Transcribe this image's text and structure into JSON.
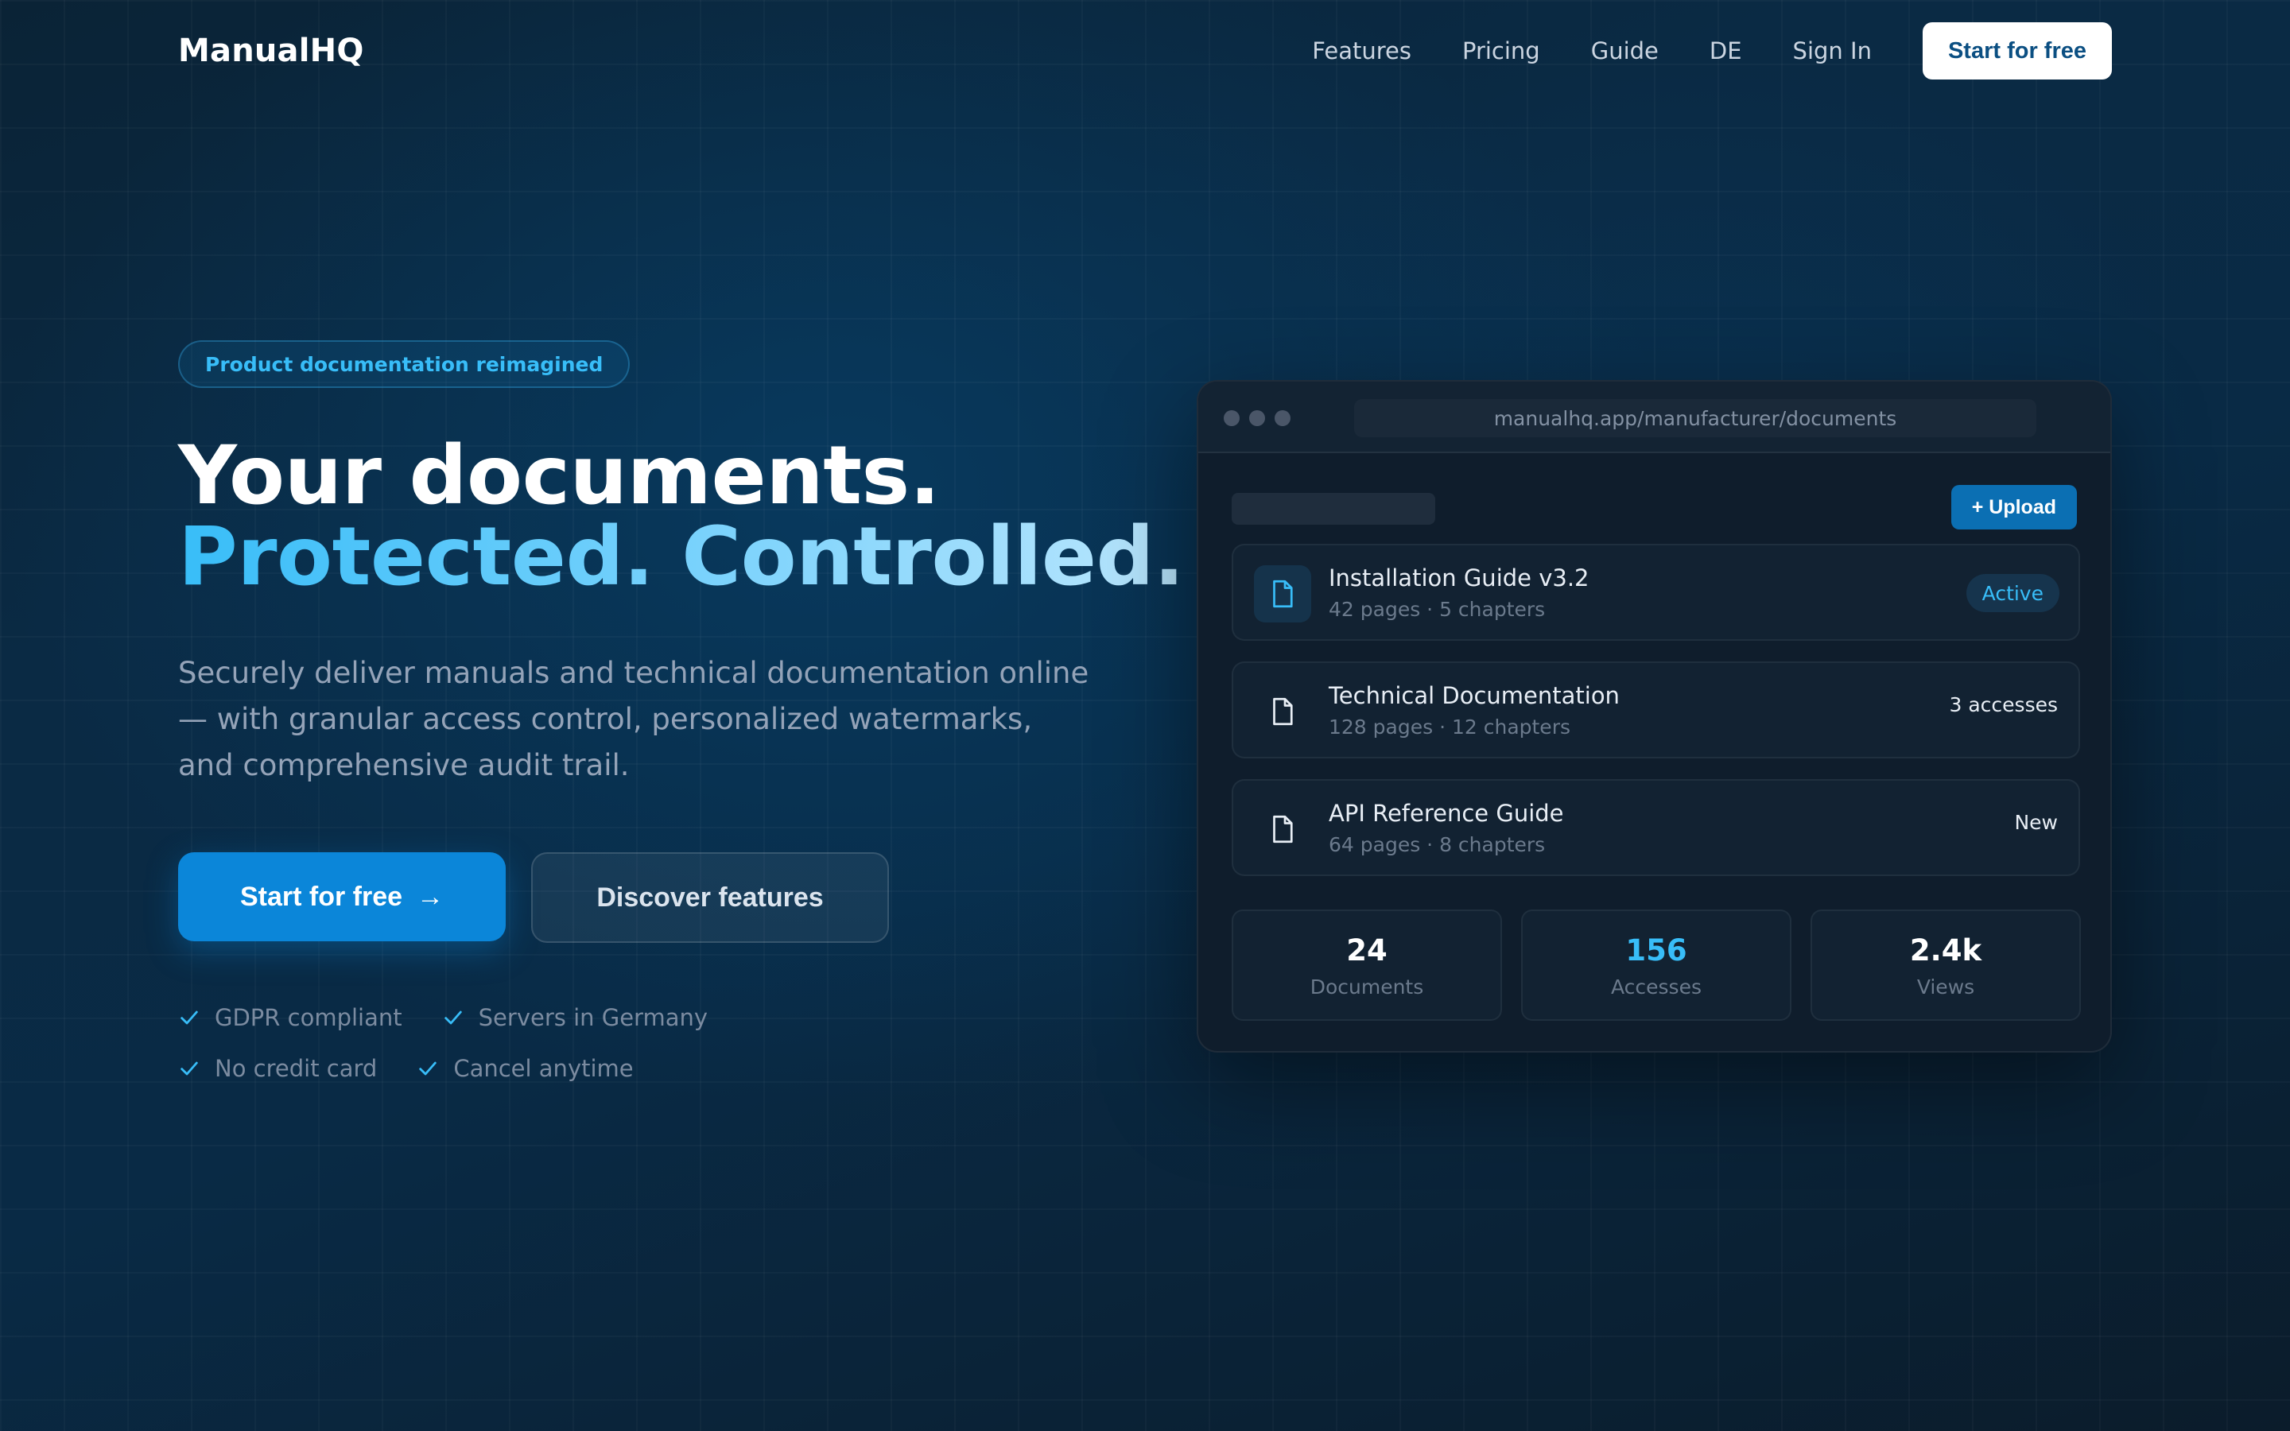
{
  "brand": {
    "name": "ManualHQ"
  },
  "nav": {
    "items": [
      "Features",
      "Pricing",
      "Guide",
      "DE",
      "Sign In"
    ],
    "cta": "Start for free"
  },
  "hero": {
    "badge": "Product documentation reimagined",
    "headline_line1": "Your documents.",
    "headline_line2": "Protected. Controlled.",
    "subtitle": "Securely deliver manuals and technical documentation online — with granular access control, personalized watermarks, and comprehensive audit trail.",
    "primary_button": "Start for free",
    "primary_button_arrow": "→",
    "secondary_button": "Discover features",
    "checks": [
      "GDPR compliant",
      "Servers in Germany",
      "No credit card",
      "Cancel anytime"
    ]
  },
  "mockup": {
    "url": "manualhq.app/manufacturer/documents",
    "upload_button": "+ Upload",
    "documents": [
      {
        "title": "Installation Guide v3.2",
        "meta": "42 pages · 5 chapters",
        "status": "Active",
        "icon": "file-icon"
      },
      {
        "title": "Technical Documentation",
        "meta": "128 pages · 12 chapters",
        "status": "3 accesses",
        "icon": "file-icon"
      },
      {
        "title": "API Reference Guide",
        "meta": "64 pages · 8 chapters",
        "status": "New",
        "icon": "file-icon"
      }
    ],
    "stats": [
      {
        "value": "24",
        "label": "Documents"
      },
      {
        "value": "156",
        "label": "Accesses"
      },
      {
        "value": "2.4k",
        "label": "Views"
      }
    ]
  },
  "colors": {
    "accent": "#38bdf8",
    "primary_button": "#0b86d9",
    "background": "#0a2a44"
  }
}
